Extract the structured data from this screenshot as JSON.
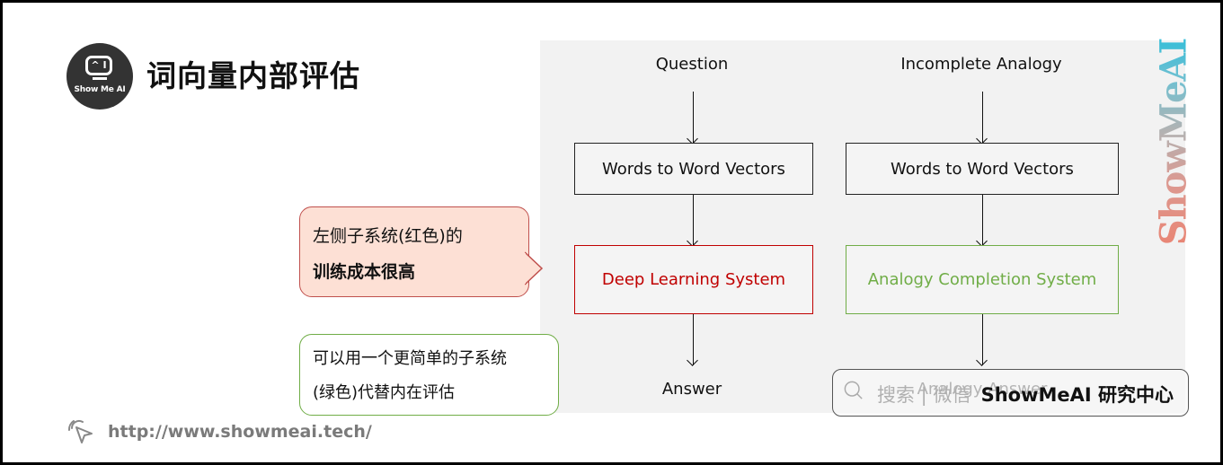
{
  "header": {
    "logo": {
      "screen_text": "^ I",
      "brand": "Show Me AI"
    },
    "title": "词向量内部评估"
  },
  "diagram": {
    "left_column": {
      "input": "Question",
      "step1": "Words to Word Vectors",
      "system": "Deep Learning System",
      "output": "Answer"
    },
    "right_column": {
      "input": "Incomplete Analogy",
      "step1": "Words to Word Vectors",
      "system": "Analogy Completion System",
      "output": "Analogy Answer"
    },
    "colors": {
      "red_system": "#c00000",
      "green_system": "#70ad47",
      "panel_bg": "#f2f2f2"
    }
  },
  "callouts": {
    "red": {
      "line1": "左侧子系统(红色)的",
      "line2": "训练成本很高"
    },
    "green": {
      "line1": "可以用一个更简单的子系统",
      "line2": "(绿色)代替内在评估"
    }
  },
  "watermark": {
    "text": "ShowMeAI"
  },
  "search_bar": {
    "placeholder": "搜索 | 微信",
    "brand": "ShowMeAI 研究中心",
    "icon": "search-icon"
  },
  "footer": {
    "icon": "cursor-click-icon",
    "url": "http://www.showmeai.tech/"
  }
}
